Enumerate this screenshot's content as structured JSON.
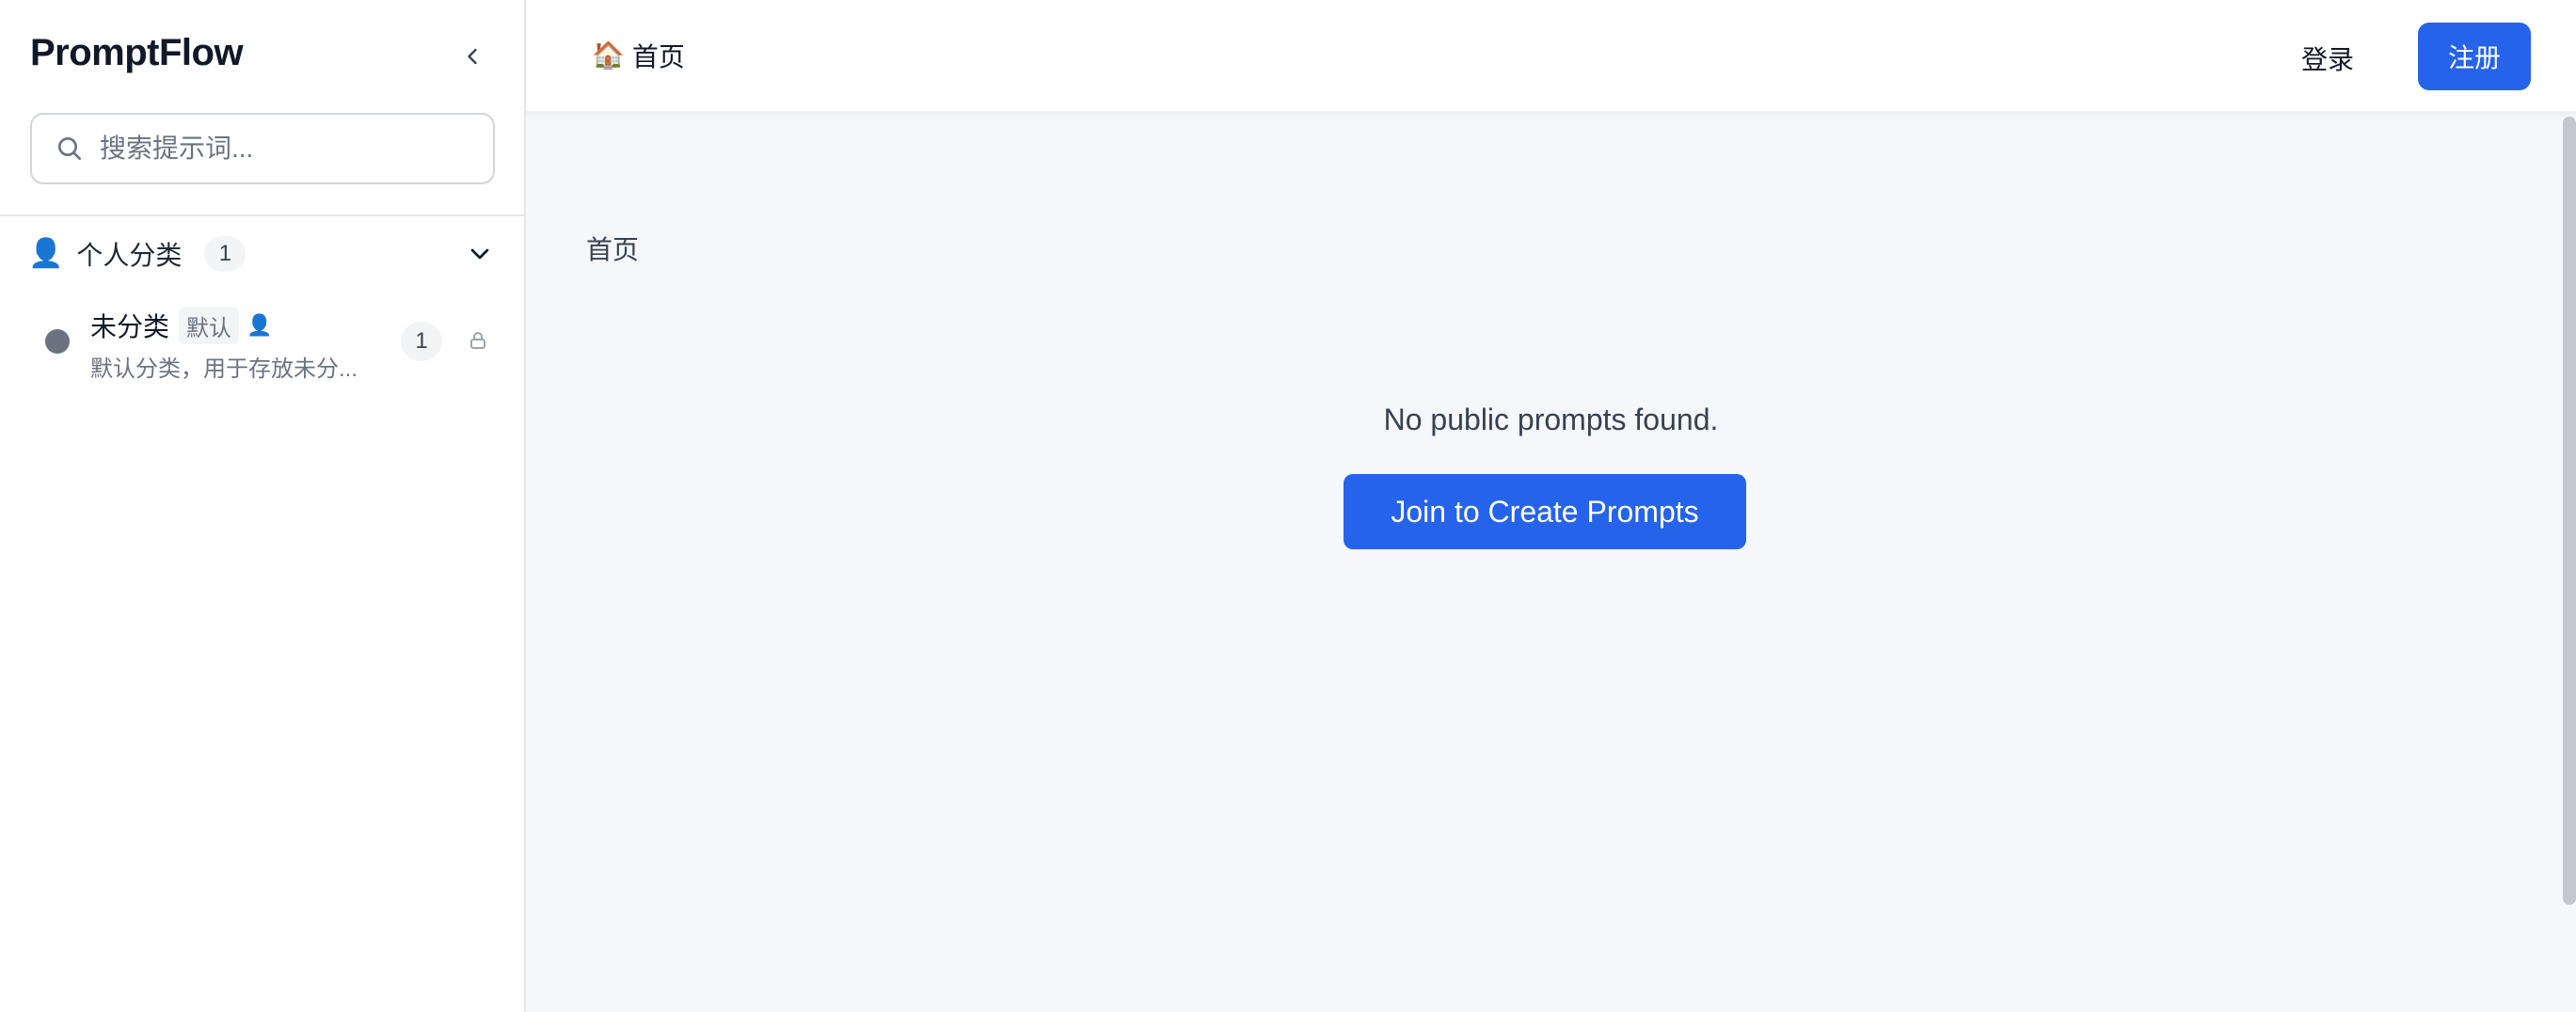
{
  "sidebar": {
    "brand": "PromptFlow",
    "search_placeholder": "搜索提示词...",
    "group": {
      "icon": "👤",
      "label": "个人分类",
      "count": "1"
    },
    "categories": [
      {
        "name": "未分类",
        "badge": "默认",
        "owner_icon": "👤",
        "description": "默认分类，用于存放未分...",
        "count": "1",
        "dot_color": "#6b7280"
      }
    ]
  },
  "topbar": {
    "home_icon": "🏠",
    "home_label": "首页",
    "login_label": "登录",
    "register_label": "注册"
  },
  "main": {
    "page_title": "首页",
    "empty_message": "No public prompts found.",
    "cta_label": "Join to Create Prompts"
  },
  "colors": {
    "accent": "#2563eb",
    "main_bg": "#f5f7fa"
  }
}
